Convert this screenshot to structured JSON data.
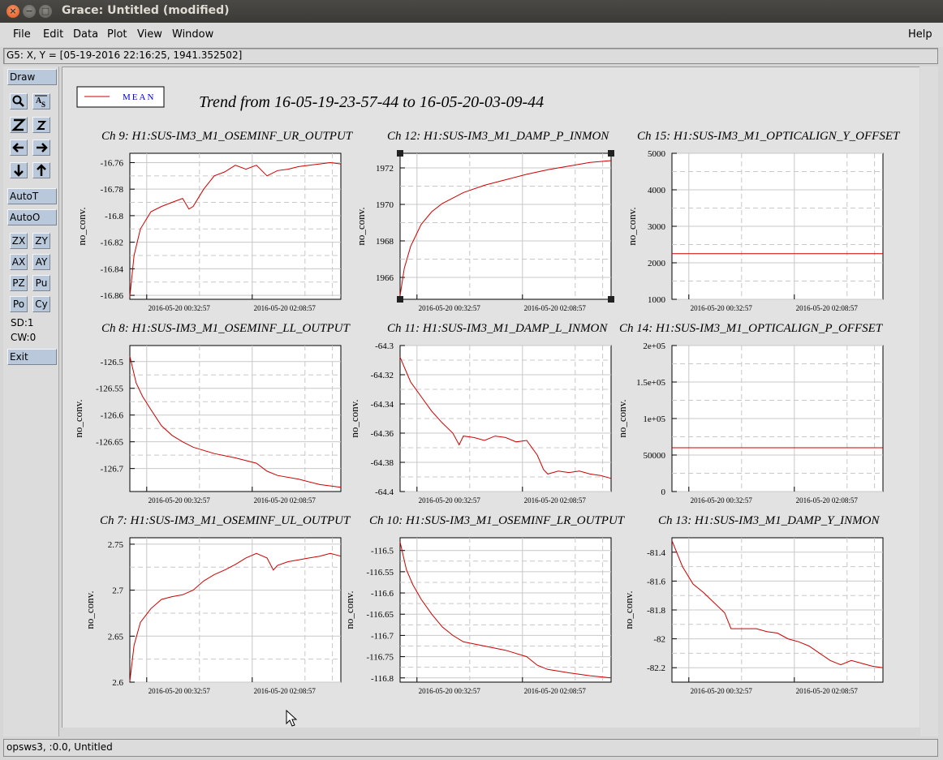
{
  "window": {
    "title": "Grace: Untitled (modified)",
    "close_glyph": "×",
    "min_glyph": "−",
    "max_glyph": "□"
  },
  "menu": {
    "file": "File",
    "edit": "Edit",
    "data": "Data",
    "plot": "Plot",
    "view": "View",
    "window": "Window",
    "help": "Help"
  },
  "coord_readout": "G5: X, Y = [05-19-2016 22:16:25, 1941.352502]",
  "toolbar": {
    "draw": "Draw",
    "autot": "AutoT",
    "autoo": "AutoO",
    "zx": "ZX",
    "zy": "ZY",
    "ax": "AX",
    "ay": "AY",
    "pz": "PZ",
    "pu": "Pu",
    "po": "Po",
    "cy": "Cy",
    "sd": "SD:1",
    "cw": "CW:0",
    "exit": "Exit",
    "icons": [
      "zoom-icon",
      "autoscale-text-icon",
      "zoom-in-icon",
      "zoom-out-icon",
      "left-arrow-icon",
      "right-arrow-icon",
      "down-arrow-icon",
      "up-arrow-icon"
    ]
  },
  "status": "opsws3, :0.0, Untitled",
  "colors": {
    "series": "#cc0000",
    "legend_text": "#0000cc",
    "button": "#b9c8da",
    "titlebar": "#3c3b37",
    "close": "#e05a28"
  },
  "chart_data": {
    "title": "Trend from 16-05-19-23-57-44 to 16-05-20-03-09-44",
    "legend": "MEAN",
    "panels": [
      {
        "title": "Ch 9: H1:SUS-IM3_M1_OSEMINF_UR_OUTPUT",
        "type": "line",
        "ylabel": "no_conv.",
        "yticks": [
          "-16.76",
          "-16.78",
          "-16.8",
          "-16.82",
          "-16.84",
          "-16.86"
        ],
        "xticks": [
          "2016-05-20 00:32:57",
          "2016-05-20 02:08:57"
        ],
        "ylim": [
          -16.863,
          -16.753
        ],
        "x": [
          0,
          0.02,
          0.05,
          0.1,
          0.15,
          0.2,
          0.25,
          0.28,
          0.3,
          0.35,
          0.4,
          0.45,
          0.5,
          0.55,
          0.6,
          0.65,
          0.7,
          0.75,
          0.8,
          0.85,
          0.9,
          0.95,
          1.0
        ],
        "values": [
          -16.861,
          -16.83,
          -16.81,
          -16.797,
          -16.793,
          -16.79,
          -16.787,
          -16.795,
          -16.793,
          -16.78,
          -16.77,
          -16.767,
          -16.762,
          -16.765,
          -16.762,
          -16.77,
          -16.766,
          -16.765,
          -16.763,
          -16.762,
          -16.761,
          -16.76,
          -16.761
        ]
      },
      {
        "title": "Ch 12: H1:SUS-IM3_M1_DAMP_P_INMON",
        "type": "line",
        "ylabel": "no_conv.",
        "yticks": [
          "1972",
          "1970",
          "1968",
          "1966"
        ],
        "xticks": [
          "2016-05-20 00:32:57",
          "2016-05-20 02:08:57"
        ],
        "ylim": [
          1964.8,
          1972.8
        ],
        "x": [
          0,
          0.02,
          0.05,
          0.1,
          0.15,
          0.2,
          0.3,
          0.4,
          0.5,
          0.6,
          0.7,
          0.8,
          0.9,
          1.0
        ],
        "values": [
          1965.0,
          1966.5,
          1967.7,
          1968.9,
          1969.6,
          1970.05,
          1970.65,
          1971.05,
          1971.35,
          1971.65,
          1971.9,
          1972.1,
          1972.3,
          1972.4
        ]
      },
      {
        "title": "Ch 15: H1:SUS-IM3_M1_OPTICALIGN_Y_OFFSET",
        "type": "line",
        "ylabel": "no_conv.",
        "yticks": [
          "5000",
          "4000",
          "3000",
          "2000",
          "1000"
        ],
        "xticks": [
          "2016-05-20 00:32:57",
          "2016-05-20 02:08:57"
        ],
        "ylim": [
          1000,
          5000
        ],
        "x": [
          0,
          1.0
        ],
        "values": [
          2250,
          2250
        ]
      },
      {
        "title": "Ch 8: H1:SUS-IM3_M1_OSEMINF_LL_OUTPUT",
        "type": "line",
        "ylabel": "no_conv.",
        "yticks": [
          "-126.5",
          "-126.55",
          "-126.6",
          "-126.65",
          "-126.7"
        ],
        "xticks": [
          "2016-05-20 00:32:57",
          "2016-05-20 02:08:57"
        ],
        "ylim": [
          -126.743,
          -126.47
        ],
        "x": [
          0,
          0.03,
          0.06,
          0.1,
          0.15,
          0.2,
          0.25,
          0.3,
          0.4,
          0.5,
          0.6,
          0.65,
          0.7,
          0.8,
          0.9,
          1.0
        ],
        "values": [
          -126.49,
          -126.54,
          -126.565,
          -126.59,
          -126.62,
          -126.638,
          -126.65,
          -126.66,
          -126.672,
          -126.68,
          -126.69,
          -126.705,
          -126.713,
          -126.72,
          -126.73,
          -126.735
        ]
      },
      {
        "title": "Ch 11: H1:SUS-IM3_M1_DAMP_L_INMON",
        "type": "line",
        "ylabel": "no_conv.",
        "yticks": [
          "-64.3",
          "-64.32",
          "-64.34",
          "-64.36",
          "-64.38",
          "-64.4"
        ],
        "xticks": [
          "2016-05-20 00:32:57",
          "2016-05-20 02:08:57"
        ],
        "ylim": [
          -64.4,
          -64.3
        ],
        "x": [
          0,
          0.05,
          0.1,
          0.15,
          0.2,
          0.25,
          0.28,
          0.3,
          0.35,
          0.4,
          0.45,
          0.5,
          0.55,
          0.6,
          0.65,
          0.68,
          0.7,
          0.75,
          0.8,
          0.85,
          0.9,
          0.95,
          1.0
        ],
        "values": [
          -64.308,
          -64.325,
          -64.335,
          -64.345,
          -64.353,
          -64.36,
          -64.368,
          -64.362,
          -64.363,
          -64.365,
          -64.362,
          -64.363,
          -64.366,
          -64.365,
          -64.375,
          -64.385,
          -64.388,
          -64.386,
          -64.387,
          -64.386,
          -64.388,
          -64.389,
          -64.391
        ]
      },
      {
        "title": "Ch 14: H1:SUS-IM3_M1_OPTICALIGN_P_OFFSET",
        "type": "line",
        "ylabel": "no_conv.",
        "yticks": [
          "2e+05",
          "1.5e+05",
          "1e+05",
          "50000",
          "0"
        ],
        "xticks": [
          "2016-05-20 00:32:57",
          "2016-05-20 02:08:57"
        ],
        "ylim": [
          0,
          200000
        ],
        "x": [
          0,
          1.0
        ],
        "values": [
          60000,
          60000
        ]
      },
      {
        "title": "Ch 7: H1:SUS-IM3_M1_OSEMINF_UL_OUTPUT",
        "type": "line",
        "ylabel": "no_conv.",
        "yticks": [
          "2.75",
          "2.7",
          "2.65",
          "2.6"
        ],
        "xticks": [
          "2016-05-20 00:32:57",
          "2016-05-20 02:08:57"
        ],
        "ylim": [
          2.6,
          2.757
        ],
        "x": [
          0,
          0.02,
          0.05,
          0.1,
          0.15,
          0.2,
          0.25,
          0.3,
          0.35,
          0.4,
          0.45,
          0.5,
          0.55,
          0.6,
          0.65,
          0.68,
          0.7,
          0.75,
          0.8,
          0.85,
          0.9,
          0.95,
          1.0
        ],
        "values": [
          2.601,
          2.64,
          2.665,
          2.68,
          2.69,
          2.693,
          2.695,
          2.7,
          2.71,
          2.717,
          2.722,
          2.728,
          2.735,
          2.74,
          2.735,
          2.722,
          2.727,
          2.731,
          2.733,
          2.735,
          2.737,
          2.74,
          2.737
        ]
      },
      {
        "title": "Ch 10: H1:SUS-IM3_M1_OSEMINF_LR_OUTPUT",
        "type": "line",
        "ylabel": "no_conv.",
        "yticks": [
          "-116.5",
          "-116.55",
          "-116.6",
          "-116.65",
          "-116.7",
          "-116.75",
          "-116.8"
        ],
        "xticks": [
          "2016-05-20 00:32:57",
          "2016-05-20 02:08:57"
        ],
        "ylim": [
          -116.81,
          -116.47
        ],
        "x": [
          0,
          0.03,
          0.06,
          0.1,
          0.15,
          0.2,
          0.25,
          0.3,
          0.4,
          0.5,
          0.6,
          0.65,
          0.7,
          0.8,
          0.9,
          1.0
        ],
        "values": [
          -116.48,
          -116.545,
          -116.58,
          -116.615,
          -116.65,
          -116.68,
          -116.7,
          -116.715,
          -116.725,
          -116.735,
          -116.75,
          -116.77,
          -116.78,
          -116.788,
          -116.795,
          -116.8
        ]
      },
      {
        "title": "Ch 13: H1:SUS-IM3_M1_DAMP_Y_INMON",
        "type": "line",
        "ylabel": "no_conv.",
        "yticks": [
          "-81.4",
          "-81.6",
          "-81.8",
          "-82",
          "-82.2"
        ],
        "xticks": [
          "2016-05-20 00:32:57",
          "2016-05-20 02:08:57"
        ],
        "ylim": [
          -82.3,
          -81.3
        ],
        "x": [
          0,
          0.05,
          0.1,
          0.15,
          0.2,
          0.25,
          0.28,
          0.3,
          0.35,
          0.4,
          0.45,
          0.5,
          0.55,
          0.6,
          0.65,
          0.7,
          0.75,
          0.8,
          0.85,
          0.9,
          0.95,
          1.0
        ],
        "values": [
          -81.32,
          -81.5,
          -81.62,
          -81.68,
          -81.75,
          -81.82,
          -81.93,
          -81.93,
          -81.93,
          -81.93,
          -81.95,
          -81.96,
          -82.0,
          -82.02,
          -82.05,
          -82.1,
          -82.15,
          -82.18,
          -82.15,
          -82.17,
          -82.19,
          -82.2
        ]
      }
    ]
  }
}
